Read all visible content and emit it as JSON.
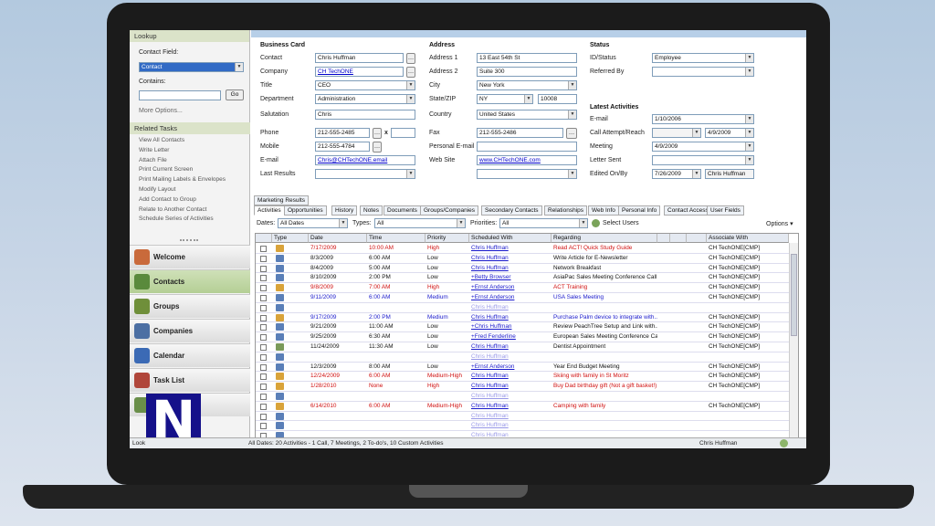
{
  "sidebar": {
    "lookup_title": "Lookup",
    "contact_field_label": "Contact Field:",
    "contact_field_value": "Contact",
    "contains_label": "Contains:",
    "contains_value": "",
    "go_label": "Go",
    "more_options": "More Options...",
    "related_tasks_title": "Related Tasks",
    "related_tasks": [
      "View All Contacts",
      "Write Letter",
      "Attach File",
      "Print Current Screen",
      "Print Mailing Labels & Envelopes",
      "Modify Layout",
      "Add Contact to Group",
      "Relate to Another Contact",
      "Schedule Series of Activities"
    ],
    "nav": [
      {
        "label": "Welcome",
        "icon": "welcome-icon",
        "color": "#c96a3b"
      },
      {
        "label": "Contacts",
        "icon": "contacts-icon",
        "color": "#5a8a3c"
      },
      {
        "label": "Groups",
        "icon": "groups-icon",
        "color": "#6f8f3a"
      },
      {
        "label": "Companies",
        "icon": "companies-icon",
        "color": "#4c6fa3"
      },
      {
        "label": "Calendar",
        "icon": "calendar-icon",
        "color": "#3b6ab5"
      },
      {
        "label": "Task List",
        "icon": "task-list-icon",
        "color": "#b0463a"
      },
      {
        "label": "",
        "icon": "chart-icon",
        "color": "#6a8f4a"
      }
    ],
    "active_nav": "Contacts"
  },
  "business_card": {
    "title": "Business Card",
    "contact_label": "Contact",
    "contact": "Chris Huffman",
    "company_label": "Company",
    "company": "CH TechONE",
    "title_label": "Title",
    "title_value": "CEO",
    "department_label": "Department",
    "department": "Administration",
    "salutation_label": "Salutation",
    "salutation": "Chris",
    "phone_label": "Phone",
    "phone": "212-555-2485",
    "phone_ext_x": "x",
    "mobile_label": "Mobile",
    "mobile": "212-555-4784",
    "email_label": "E-mail",
    "email": "Chris@CHTechONE.email",
    "last_results_label": "Last Results",
    "last_results": ""
  },
  "address": {
    "title": "Address",
    "address1_label": "Address 1",
    "address1": "13 East 54th St",
    "address2_label": "Address 2",
    "address2": "Suite 300",
    "city_label": "City",
    "city": "New York",
    "state_zip_label": "State/ZIP",
    "state": "NY",
    "zip": "10008",
    "country_label": "Country",
    "country": "United States",
    "fax_label": "Fax",
    "fax": "212-555-2486",
    "personal_email_label": "Personal E-mail",
    "personal_email": "",
    "web_site_label": "Web Site",
    "web_site": "www.CHTechONE.com"
  },
  "status": {
    "title": "Status",
    "id_status_label": "ID/Status",
    "id_status": "Employee",
    "referred_by_label": "Referred By",
    "referred_by": ""
  },
  "latest_activities": {
    "title": "Latest Activities",
    "email_label": "E-mail",
    "email": "1/10/2006",
    "call_label": "Call Attempt/Reach",
    "call_attempt": "",
    "call_reach": "4/9/2009",
    "meeting_label": "Meeting",
    "meeting": "4/9/2009",
    "letter_label": "Letter Sent",
    "letter": "",
    "edited_label": "Edited On/By",
    "edited_on": "7/26/2009",
    "edited_by": "Chris Huffman"
  },
  "tabs_row1": [
    "Marketing Results"
  ],
  "tabs_row2": [
    "Activities",
    "Opportunities",
    "History",
    "Notes",
    "Documents",
    "Groups/Companies",
    "Secondary Contacts",
    "Relationships",
    "Web Info",
    "Personal Info",
    "Contact Access",
    "User Fields"
  ],
  "filters": {
    "dates_label": "Dates:",
    "dates": "All Dates",
    "types_label": "Types:",
    "types": "All",
    "priorities_label": "Priorities:",
    "priorities": "All",
    "select_users": "Select Users",
    "options": "Options"
  },
  "grid": {
    "columns": [
      "Type",
      "Date",
      "Time",
      "Priority",
      "Scheduled With",
      "Regarding",
      "Associate With"
    ],
    "rows": [
      {
        "type": "todo",
        "date": "7/17/2009",
        "time": "10:00 AM",
        "priority": "High",
        "with": "Chris Huffman",
        "regarding": "Read ACT! Quick Study Guide",
        "assoc": "CH TechONE[CMP]",
        "red": true
      },
      {
        "type": "meeting",
        "date": "8/3/2009",
        "time": "6:00 AM",
        "priority": "Low",
        "with": "Chris Huffman",
        "regarding": "Write Article for E-Newsletter",
        "assoc": "CH TechONE[CMP]",
        "red": false
      },
      {
        "type": "meeting",
        "date": "8/4/2009",
        "time": "5:00 AM",
        "priority": "Low",
        "with": "Chris Huffman",
        "regarding": "Network Breakfast",
        "assoc": "CH TechONE[CMP]",
        "red": false
      },
      {
        "type": "meeting",
        "date": "8/10/2009",
        "time": "2:00 PM",
        "priority": "Low",
        "with": "+Betty Browser",
        "regarding": "AsiaPac Sales Meeting Conference Call",
        "assoc": "CH TechONE[CMP]",
        "red": false
      },
      {
        "type": "todo",
        "date": "9/8/2009",
        "time": "7:00 AM",
        "priority": "High",
        "with": "+Ernst Anderson",
        "regarding": "ACT Training",
        "assoc": "CH TechONE[CMP]",
        "red": true
      },
      {
        "type": "meeting",
        "date": "9/11/2009",
        "time": "6:00 AM",
        "priority": "Medium",
        "with": "+Ernst Anderson",
        "regarding": "USA Sales Meeting",
        "assoc": "CH TechONE[CMP]",
        "red": false,
        "blue": true
      },
      {
        "type": "meeting",
        "date": "",
        "time": "",
        "priority": "",
        "with": "Chris Huffman",
        "regarding": "",
        "assoc": "",
        "red": false,
        "faded": true
      },
      {
        "type": "todo",
        "date": "9/17/2009",
        "time": "2:00 PM",
        "priority": "Medium",
        "with": "Chris Huffman",
        "regarding": "Purchase Palm device to integrate with...",
        "assoc": "CH TechONE[CMP]",
        "red": false,
        "blue": true
      },
      {
        "type": "meeting",
        "date": "9/21/2009",
        "time": "11:00 AM",
        "priority": "Low",
        "with": "+Chris Huffman",
        "regarding": "Review PeachTree Setup and Link with...",
        "assoc": "CH TechONE[CMP]",
        "red": false
      },
      {
        "type": "meeting",
        "date": "9/25/2009",
        "time": "6:30 AM",
        "priority": "Low",
        "with": "+Fred Fenderline",
        "regarding": "European Sales Meeting Conference Call",
        "assoc": "CH TechONE[CMP]",
        "red": false
      },
      {
        "type": "call",
        "date": "11/24/2009",
        "time": "11:30 AM",
        "priority": "Low",
        "with": "Chris Huffman",
        "regarding": "Dentist Appointment",
        "assoc": "CH TechONE[CMP]",
        "red": false
      },
      {
        "type": "meeting",
        "date": "",
        "time": "",
        "priority": "",
        "with": "Chris Huffman",
        "regarding": "",
        "assoc": "",
        "red": false,
        "faded": true
      },
      {
        "type": "meeting",
        "date": "12/3/2009",
        "time": "8:00 AM",
        "priority": "Low",
        "with": "+Ernst Anderson",
        "regarding": "Year End Budget Meeting",
        "assoc": "CH TechONE[CMP]",
        "red": false
      },
      {
        "type": "todo",
        "date": "12/24/2009",
        "time": "6:00 AM",
        "priority": "Medium-High",
        "with": "Chris Huffman",
        "regarding": "Skiing with family in St Moritz",
        "assoc": "CH TechONE[CMP]",
        "red": true
      },
      {
        "type": "todo",
        "date": "1/28/2010",
        "time": "None",
        "priority": "High",
        "with": "Chris Huffman",
        "regarding": "Buy Dad birthday gift (Not a gift basket!)",
        "assoc": "CH TechONE[CMP]",
        "red": true
      },
      {
        "type": "meeting",
        "date": "",
        "time": "",
        "priority": "",
        "with": "Chris Huffman",
        "regarding": "",
        "assoc": "",
        "red": false,
        "faded": true
      },
      {
        "type": "todo",
        "date": "6/14/2010",
        "time": "6:00 AM",
        "priority": "Medium-High",
        "with": "Chris Huffman",
        "regarding": "Camping with family",
        "assoc": "CH TechONE[CMP]",
        "red": true
      },
      {
        "type": "meeting",
        "date": "",
        "time": "",
        "priority": "",
        "with": "Chris Huffman",
        "regarding": "",
        "assoc": "",
        "red": false,
        "faded": true
      },
      {
        "type": "meeting",
        "date": "",
        "time": "",
        "priority": "",
        "with": "Chris Huffman",
        "regarding": "",
        "assoc": "",
        "red": false,
        "faded": true
      },
      {
        "type": "meeting",
        "date": "",
        "time": "",
        "priority": "",
        "with": "Chris Huffman",
        "regarding": "",
        "assoc": "",
        "red": false,
        "faded": true
      }
    ]
  },
  "statusbar": {
    "left": "Look",
    "summary": "All Dates: 20 Activities - 1 Call, 7 Meetings, 2 To-do's, 10 Custom Activities",
    "user": "Chris Huffman"
  },
  "logo_letter": "N",
  "colors": {
    "accent": "#316ac5",
    "red": "#d01010",
    "blue": "#1a1acc",
    "brand_logo": "#15118a"
  }
}
